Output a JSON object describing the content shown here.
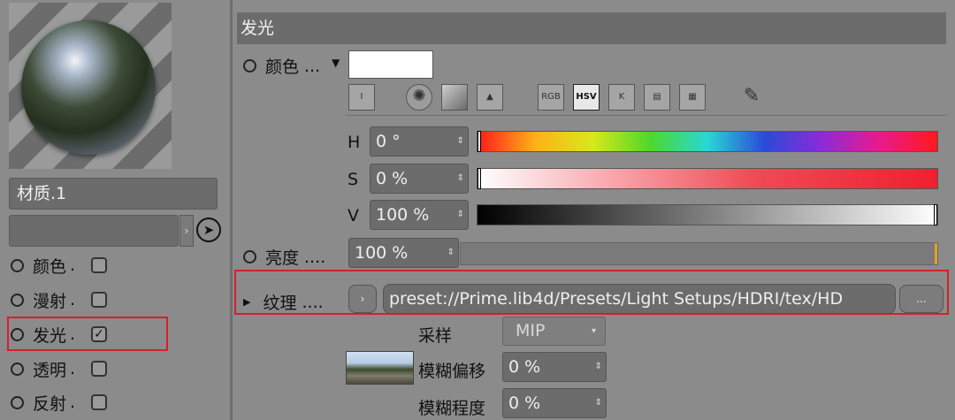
{
  "left_panel": {
    "material_name": "材质.1",
    "channels": [
      {
        "label": "颜色",
        "dots": ".",
        "checked": ""
      },
      {
        "label": "漫射",
        "dots": ".",
        "checked": ""
      },
      {
        "label": "发光",
        "dots": ".",
        "checked": "✓"
      },
      {
        "label": "透明",
        "dots": ".",
        "checked": ""
      },
      {
        "label": "反射",
        "dots": ".",
        "checked": ""
      }
    ],
    "arrow_glyph": "›",
    "picker_glyph": "➤"
  },
  "section": {
    "title": "发光"
  },
  "color_row": {
    "label": "颜色",
    "dots": "...",
    "menu_glyph": "▼",
    "swatch_color": "#ffffff"
  },
  "tools": [
    {
      "name": "spectrum-icon",
      "glyph": "Ⅰ"
    },
    {
      "name": "color-wheel-icon",
      "glyph": "✺"
    },
    {
      "name": "gradient-square-icon",
      "glyph": ""
    },
    {
      "name": "image-picker-icon",
      "glyph": "▲"
    },
    {
      "name": "rgb-mode-icon",
      "glyph": "RGB"
    },
    {
      "name": "hsv-mode-icon",
      "glyph": "HSV"
    },
    {
      "name": "kelvin-mode-icon",
      "glyph": "K"
    },
    {
      "name": "mixer-icon",
      "glyph": "▤"
    },
    {
      "name": "swatches-icon",
      "glyph": "▦"
    },
    {
      "name": "eyedropper-icon",
      "glyph": "✎"
    }
  ],
  "hsv": {
    "h": {
      "label": "H",
      "value": "0 °",
      "level": 0.0
    },
    "s": {
      "label": "S",
      "value": "0 %",
      "level": 0.0
    },
    "v": {
      "label": "V",
      "value": "100 %",
      "level": 1.0
    }
  },
  "brightness": {
    "label": "亮度",
    "dots": "....",
    "value": "100 %"
  },
  "texture": {
    "label": "纹理",
    "dots": "....",
    "path": "preset://Prime.lib4d/Presets/Light Setups/HDRI/tex/HD",
    "more": "...",
    "arrow": "›"
  },
  "sampling": {
    "label": "采样",
    "value": "MIP",
    "dropdown_glyph": "▾"
  },
  "blur_offset": {
    "label": "模糊偏移",
    "value": "0 %"
  },
  "blur_scale": {
    "label": "模糊程度",
    "value": "0 %"
  },
  "spin_glyph": "⇕",
  "colors": {
    "highlight": "#d4202c",
    "header": "#6c6c6c",
    "panel": "#8b8b8b"
  }
}
